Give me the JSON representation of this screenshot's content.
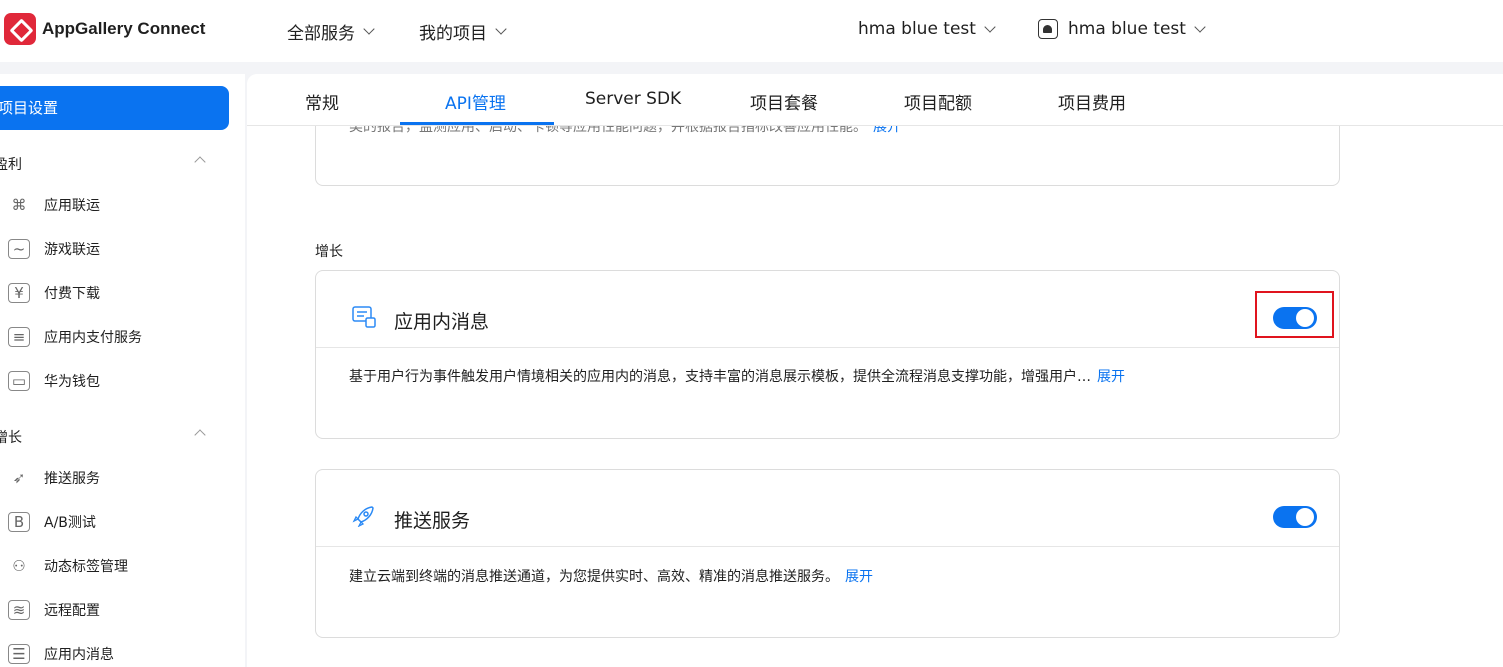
{
  "header": {
    "logo_text": "AppGallery Connect",
    "nav": [
      {
        "label": "全部服务"
      },
      {
        "label": "我的项目"
      }
    ],
    "project_selector": "hma blue test",
    "app_selector": "hma blue test"
  },
  "sidebar": {
    "active_item": "项目设置",
    "groups": [
      {
        "label": "盈利",
        "items": [
          "应用联运",
          "游戏联运",
          "付费下载",
          "应用内支付服务",
          "华为钱包"
        ]
      },
      {
        "label": "增长",
        "items": [
          "推送服务",
          "A/B测试",
          "动态标签管理",
          "远程配置",
          "应用内消息"
        ]
      }
    ]
  },
  "tabs": [
    "常规",
    "API管理",
    "Server SDK",
    "项目套餐",
    "项目配额",
    "项目费用"
  ],
  "active_tab": "API管理",
  "content": {
    "partial_card_text": "类的报告，监测应用、启动、卡顿等应用性能问题，并根据报告指标改善应用性能。",
    "partial_card_expand": "展开",
    "section_label": "增长",
    "cards": [
      {
        "title": "应用内消息",
        "description": "基于用户行为事件触发用户情境相关的应用内的消息，支持丰富的消息展示模板，提供全流程消息支撑功能，增强用户…",
        "expand": "展开",
        "enabled": true,
        "icon": "message-icon"
      },
      {
        "title": "推送服务",
        "description": "建立云端到终端的消息推送通道，为您提供实时、高效、精准的消息推送服务。",
        "expand": "展开",
        "enabled": true,
        "icon": "rocket-icon"
      }
    ]
  },
  "colors": {
    "accent": "#0a73f0",
    "highlight": "#e0141e"
  }
}
